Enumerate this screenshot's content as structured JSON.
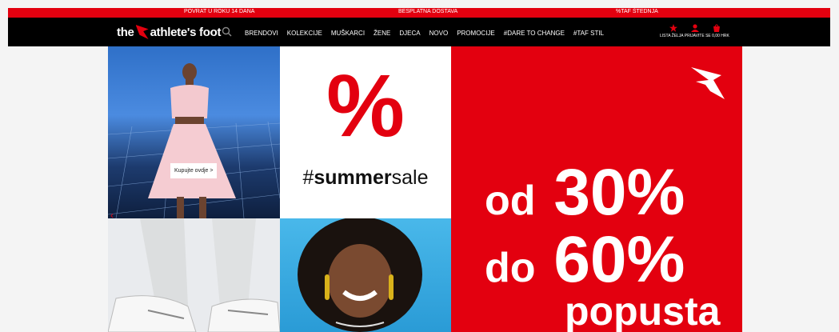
{
  "topbar": {
    "left": "POVRAT U ROKU 14 DANA",
    "center": "BESPLATNA DOSTAVA",
    "right": "%TAF ŠTEDNJA"
  },
  "brand": {
    "pre": "the",
    "name": "athlete's foot"
  },
  "menu": [
    "BRENDOVI",
    "KOLEKCIJE",
    "MUŠKARCI",
    "ŽENE",
    "DJECA",
    "NOVO",
    "PROMOCIJE",
    "#DARE TO CHANGE",
    "#TAF STIL"
  ],
  "account": {
    "wishlist": "LISTA ŽELJA",
    "login": "PRIJAVITE SE",
    "cart": "0,00 HRK"
  },
  "hero": {
    "shop_button": "Kupujte ovdje >",
    "percent": "%",
    "tag_hash": "#",
    "tag_bold": "summer",
    "tag_rest": "sale",
    "promo_line1_a": "od",
    "promo_line1_b": "30%",
    "promo_line2_a": "do",
    "promo_line2_b": "60%",
    "promo_line3": "popusta",
    "prev_arrow": "‹"
  },
  "colors": {
    "accent": "#e3000f",
    "nav": "#000000"
  },
  "icons": [
    "search-icon",
    "wishlist-star-icon",
    "user-icon",
    "cart-icon",
    "brand-wing-icon"
  ]
}
